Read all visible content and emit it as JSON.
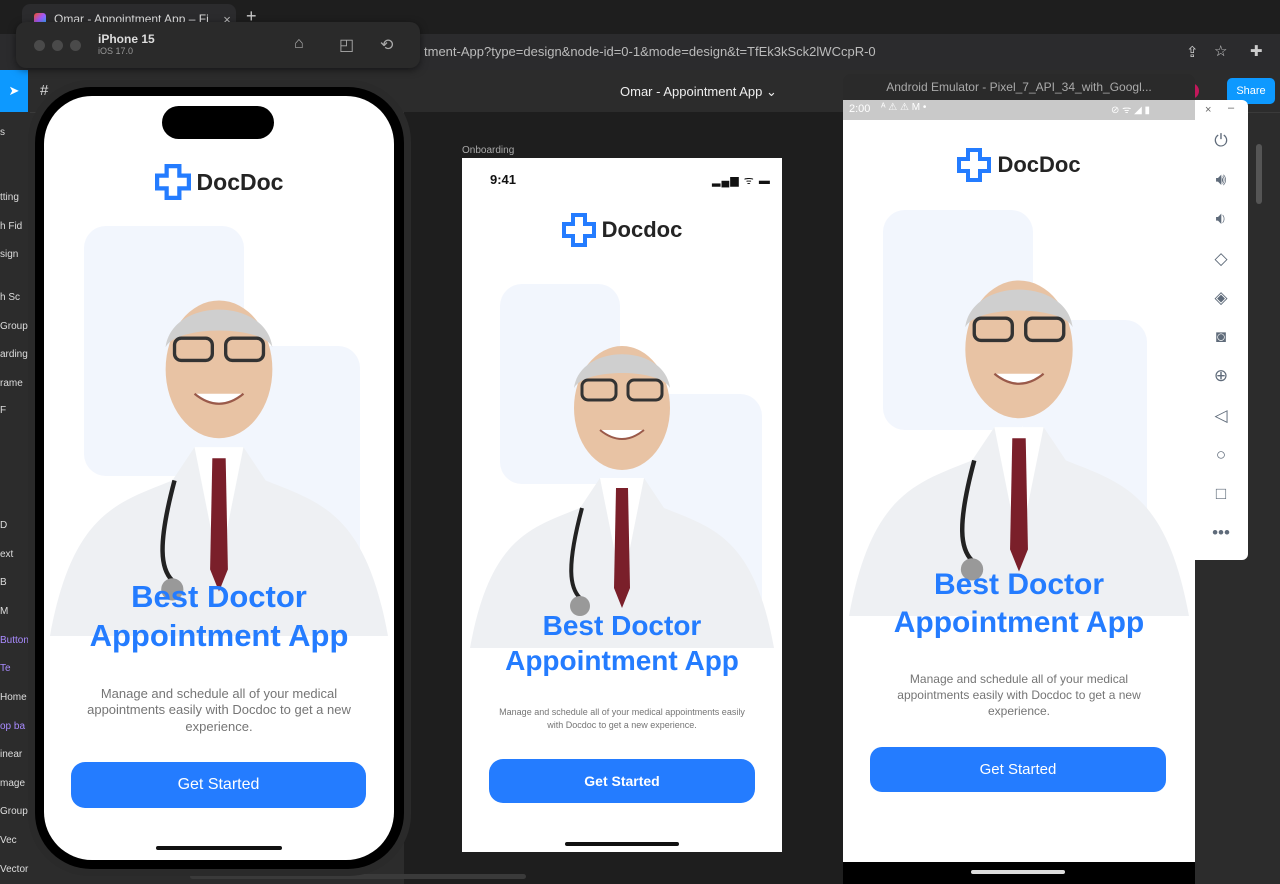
{
  "browser": {
    "tab_title": "Omar - Appointment App – Fi",
    "tab_close": "×",
    "new_tab": "+",
    "url": "tment-App?type=design&node-id=0-1&mode=design&t=TfEk3kSck2lWCcpR-0"
  },
  "figma": {
    "project_title": "Omar - Appointment App",
    "share_label": "Share",
    "frame_label": "Onboarding",
    "left_layers": [
      "s",
      "tting",
      "h Fid",
      "sign",
      "h Sc",
      "Group",
      "arding",
      "rame",
      "F",
      "D",
      "ext",
      "B",
      "M",
      "Button",
      "Te",
      "Home",
      "op ba",
      "inear",
      "mage",
      "Group",
      "Vec",
      "Vector"
    ],
    "left_layer_colors": [
      "#ddd",
      "#ddd",
      "#ddd",
      "#ddd",
      "#ddd",
      "#ddd",
      "#ddd",
      "#ddd",
      "#ddd",
      "#ddd",
      "#ddd",
      "#ddd",
      "#ddd",
      "#a98bff",
      "#a98bff",
      "#ddd",
      "#a98bff",
      "#ddd",
      "#ddd",
      "#ddd",
      "#ddd",
      "#ddd"
    ]
  },
  "ios_sim": {
    "device_name": "iPhone 15",
    "os_version": "iOS 17.0"
  },
  "android": {
    "window_title": "Android Emulator - Pixel_7_API_34_with_Googl...",
    "status_time": "2:00"
  },
  "onboarding": {
    "brand_iphone": "DocDoc",
    "brand_figma": "Docdoc",
    "brand_android": "DocDoc",
    "status_time": "9:41",
    "headline_line1": "Best Doctor",
    "headline_line2": "Appointment App",
    "description": "Manage and schedule all of your medical appointments easily with Docdoc to get a new experience.",
    "cta_label": "Get Started"
  },
  "colors": {
    "accent": "#247cff",
    "figma_blue": "#0d99ff"
  }
}
